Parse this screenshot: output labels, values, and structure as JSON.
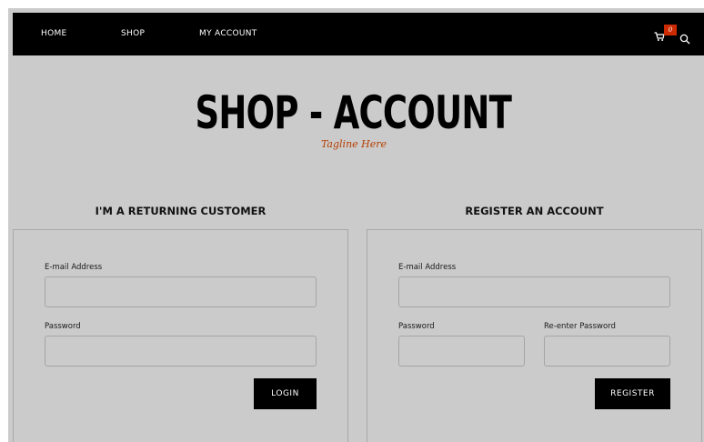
{
  "nav": {
    "items": [
      {
        "label": "HOME"
      },
      {
        "label": "SHOP"
      },
      {
        "label": "MY ACCOUNT"
      }
    ],
    "cart_count": "0",
    "cart_icon": "cart-icon",
    "search_icon": "search-icon"
  },
  "header": {
    "title": "SHOP - ACCOUNT",
    "tagline": "Tagline Here"
  },
  "login": {
    "heading": "I'M A RETURNING CUSTOMER",
    "email_label": "E-mail Address",
    "email_value": "",
    "password_label": "Password",
    "password_value": "",
    "button_label": "LOGIN"
  },
  "register": {
    "heading": "REGISTER AN ACCOUNT",
    "email_label": "E-mail Address",
    "email_value": "",
    "password_label": "Password",
    "password_value": "",
    "reenter_label": "Re-enter Password",
    "reenter_value": "",
    "button_label": "REGISTER"
  },
  "colors": {
    "background": "#cbcbcb",
    "navbar": "#000000",
    "accent": "#b83e00",
    "badge": "#cc2a00"
  }
}
